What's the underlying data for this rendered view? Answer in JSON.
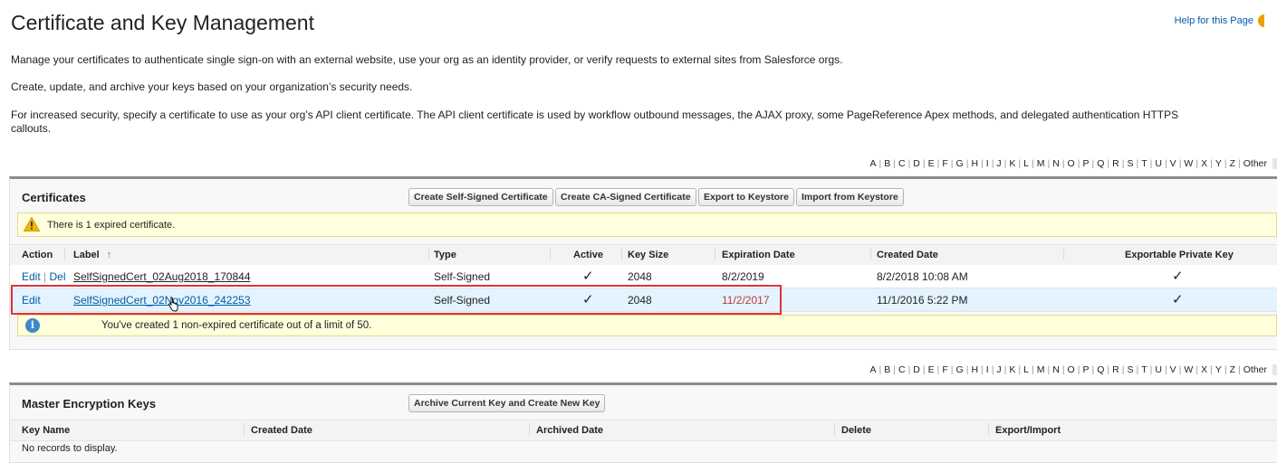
{
  "header": {
    "title": "Certificate and Key Management",
    "help_link": "Help for this Page"
  },
  "intro": {
    "p1": "Manage your certificates to authenticate single sign-on with an external website, use your org as an identity provider, or verify requests to external sites from Salesforce orgs.",
    "p2": "Create, update, and archive your keys based on your organization’s security needs.",
    "p3a": "For increased security, specify a certificate to use as your org’s API client certificate. The API client certificate is used by workflow outbound messages, the AJAX proxy, some PageReference Apex methods, and delegated authentication HTTPS",
    "p3b": "callouts."
  },
  "alphabet": [
    "A",
    "B",
    "C",
    "D",
    "E",
    "F",
    "G",
    "H",
    "I",
    "J",
    "K",
    "L",
    "M",
    "N",
    "O",
    "P",
    "Q",
    "R",
    "S",
    "T",
    "U",
    "V",
    "W",
    "X",
    "Y",
    "Z",
    "Other"
  ],
  "certificates": {
    "title": "Certificates",
    "buttons": {
      "create_self_signed": "Create Self-Signed Certificate",
      "create_ca_signed": "Create CA-Signed Certificate",
      "export_keystore": "Export to Keystore",
      "import_keystore": "Import from Keystore"
    },
    "warning": "There is 1 expired certificate.",
    "columns": {
      "action": "Action",
      "label": "Label",
      "sort_indicator": "↑",
      "type": "Type",
      "active": "Active",
      "key_size": "Key Size",
      "expiration": "Expiration Date",
      "created": "Created Date",
      "exportable": "Exportable Private Key"
    },
    "rows": [
      {
        "edit": "Edit",
        "sep": "|",
        "del": "Del",
        "label": "SelfSignedCert_02Aug2018_170844",
        "type": "Self-Signed",
        "active": "✓",
        "key_size": "2048",
        "expiration": "8/2/2019",
        "created": "8/2/2018 10:08 AM",
        "exportable": "✓"
      },
      {
        "edit": "Edit",
        "label": "SelfSignedCert_02Nov2016_242253",
        "type": "Self-Signed",
        "active": "✓",
        "key_size": "2048",
        "expiration": "11/2/2017",
        "created": "11/1/2016 5:22 PM",
        "exportable": "✓"
      }
    ],
    "info": "You've created 1 non-expired certificate out of a limit of 50."
  },
  "master_keys": {
    "title": "Master Encryption Keys",
    "button": "Archive Current Key and Create New Key",
    "columns": {
      "key_name": "Key Name",
      "created": "Created Date",
      "archived": "Archived Date",
      "delete": "Delete",
      "export_import": "Export/Import"
    },
    "empty": "No records to display."
  },
  "colors": {
    "link": "#015ba7",
    "expired": "#c23934",
    "highlight_border": "#e0323c",
    "warning_bg": "#ffffdc"
  }
}
